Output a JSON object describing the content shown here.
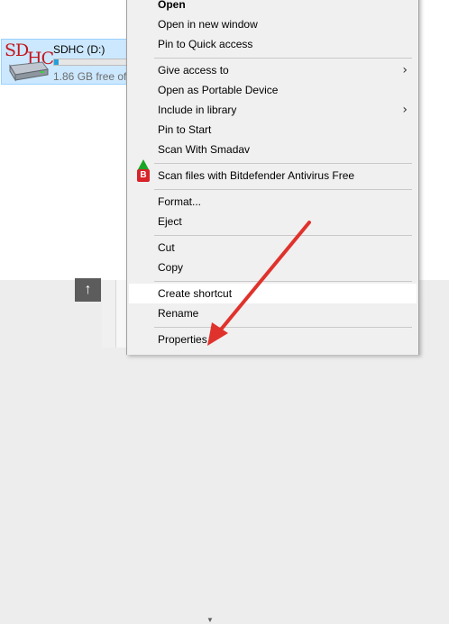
{
  "drive": {
    "logo_primary": "SD",
    "logo_secondary": "HC",
    "name": "SDHC (D:)",
    "free": "1.86 GB free of",
    "used_fraction": 0.05
  },
  "nav": {
    "up_icon": "↑"
  },
  "menu": {
    "items": [
      {
        "label": "Open"
      },
      {
        "label": "Open in new window"
      },
      {
        "label": "Pin to Quick access"
      },
      {
        "label": "Give access to"
      },
      {
        "label": "Open as Portable Device"
      },
      {
        "label": "Include in library"
      },
      {
        "label": "Pin to Start"
      },
      {
        "label": "Scan With Smadav"
      },
      {
        "label": "Scan files with Bitdefender Antivirus Free"
      },
      {
        "label": "Format..."
      },
      {
        "label": "Eject"
      },
      {
        "label": "Cut"
      },
      {
        "label": "Copy"
      },
      {
        "label": "Create shortcut"
      },
      {
        "label": "Rename"
      },
      {
        "label": "Properties"
      }
    ],
    "submenu_arrow": "›",
    "bitdefender_glyph": "B"
  },
  "colors": {
    "selection": "#cce8ff",
    "sd_logo": "#c4161c",
    "smadav": "#1aa527",
    "bitdefender": "#d8232a",
    "annotation_arrow": "#e0322c"
  }
}
